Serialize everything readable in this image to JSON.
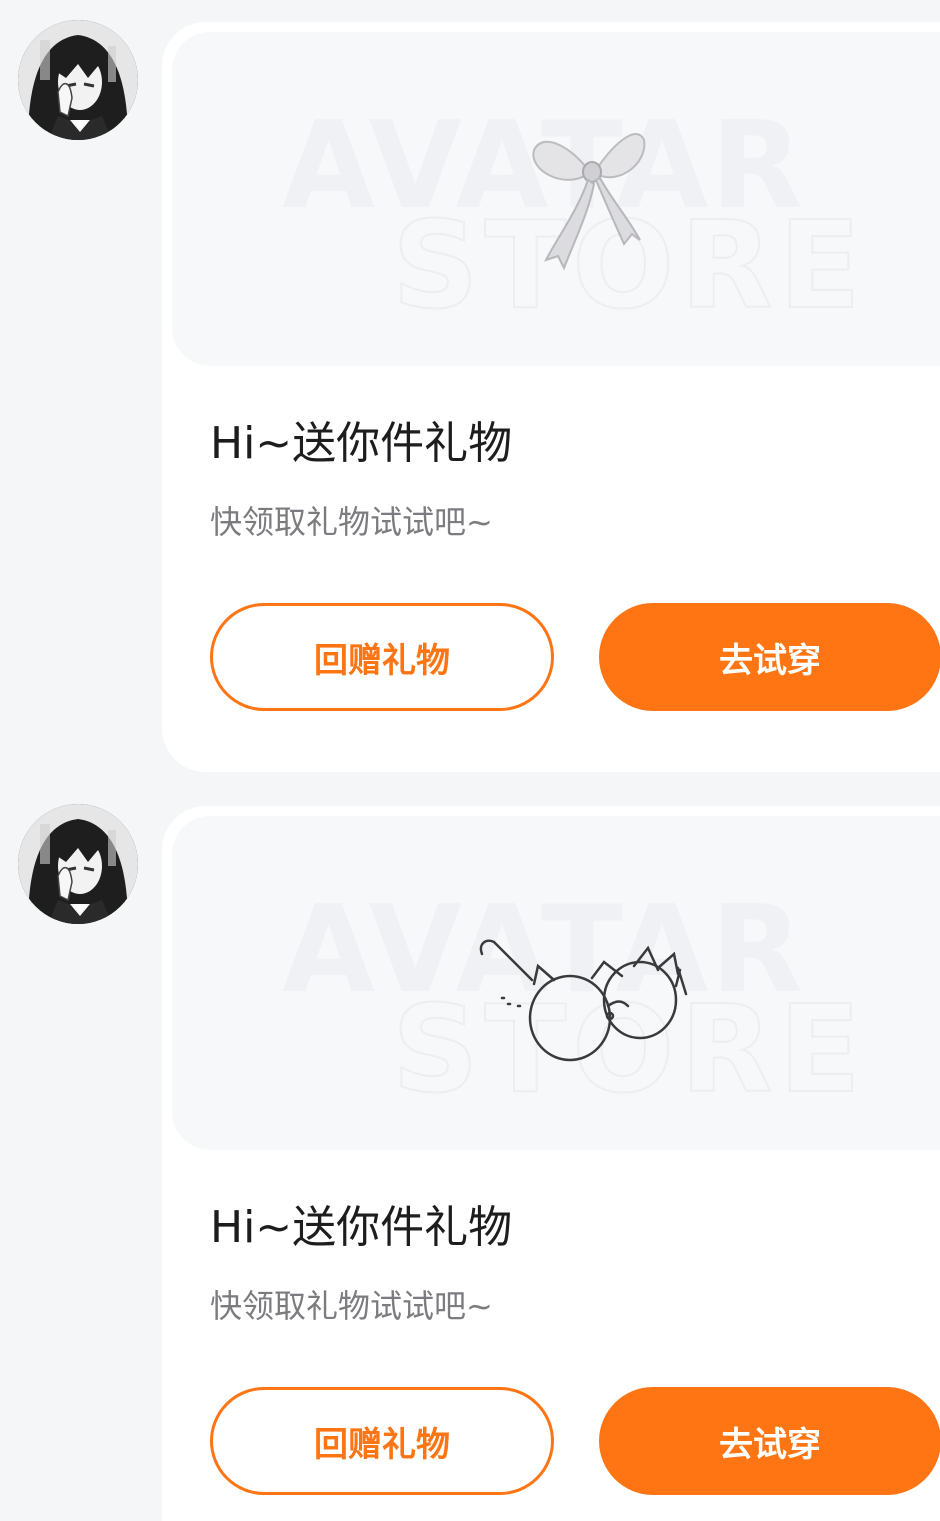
{
  "messages": [
    {
      "avatar_icon": "user-avatar",
      "watermark": [
        "AVATAR",
        "STORE"
      ],
      "item_icon": "bow-ribbon-icon",
      "title": "Hi~送你件礼物",
      "subtitle": "快领取礼物试试吧~",
      "return_gift_label": "回赠礼物",
      "try_on_label": "去试穿"
    },
    {
      "avatar_icon": "user-avatar",
      "watermark": [
        "AVATAR",
        "STORE"
      ],
      "item_icon": "cat-ear-glasses-icon",
      "title": "Hi~送你件礼物",
      "subtitle": "快领取礼物试试吧~",
      "return_gift_label": "回赠礼物",
      "try_on_label": "去试穿"
    }
  ],
  "colors": {
    "accent": "#ff7413",
    "background": "#f5f6f8",
    "card": "#ffffff",
    "preview": "#f7f8fa"
  }
}
